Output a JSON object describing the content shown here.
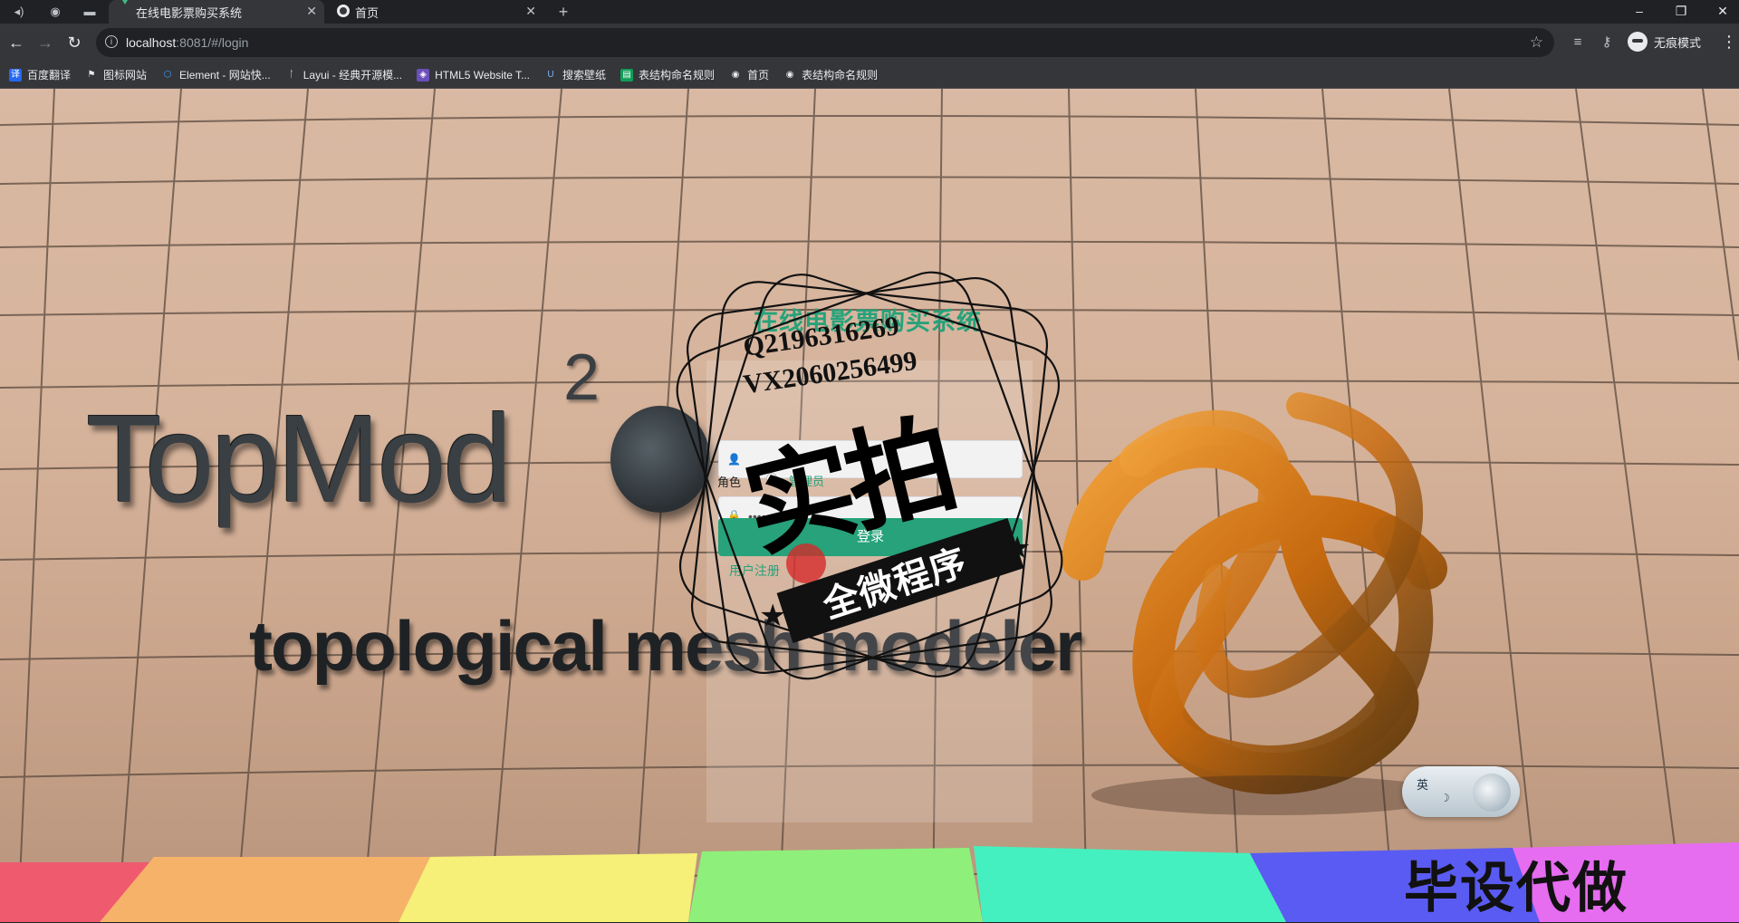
{
  "browser": {
    "tabs": [
      {
        "title": "在线电影票购买系统",
        "active": true
      },
      {
        "title": "首页",
        "active": false
      }
    ],
    "new_tab": "+",
    "url_host": "localhost",
    "url_rest": ":8081/#/login",
    "profile_label": "无痕模式",
    "bookmarks": [
      {
        "label": "百度翻译",
        "icon": "baidu-translate-icon",
        "color": "#2468f2"
      },
      {
        "label": "图标网站",
        "icon": "flag-icon",
        "color": "#ffffff"
      },
      {
        "label": "Element - 网站快...",
        "icon": "element-icon",
        "color": "#409eff"
      },
      {
        "label": "Layui - 经典开源模...",
        "icon": "layui-icon",
        "color": "#e8eaed"
      },
      {
        "label": "HTML5 Website T...",
        "icon": "html5-icon",
        "color": "#6b4fbb"
      },
      {
        "label": "搜索壁纸",
        "icon": "wallpaper-icon",
        "color": "#3c7dd9"
      },
      {
        "label": "表结构命名规则",
        "icon": "sheet-icon",
        "color": "#0f9d58"
      },
      {
        "label": "首页",
        "icon": "globe-icon",
        "color": "#e8eaed"
      },
      {
        "label": "表结构命名规则",
        "icon": "globe-icon",
        "color": "#e8eaed"
      }
    ]
  },
  "background": {
    "brand": "TopMod",
    "brand_sup": "2",
    "tagline": "topological mesh modeler"
  },
  "login": {
    "title": "在线电影票购买系统",
    "username_value": "",
    "password_value": "••••••",
    "role_label": "角色",
    "role_option": "管理员",
    "submit_label": "登录",
    "register_label": "用户注册",
    "accent_color": "#27a27a"
  },
  "watermark": {
    "qq": "Q2196316269",
    "vx": "VX2060256499",
    "big_text": "实拍",
    "ribbon_text": "全微程序",
    "corner_text": "毕设代做"
  },
  "ime": {
    "label": "英"
  }
}
